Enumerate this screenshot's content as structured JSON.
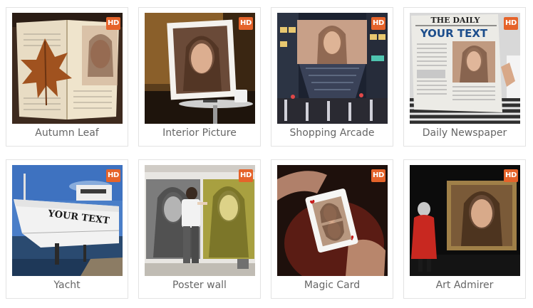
{
  "badge_label": "HD",
  "accent_color": "#e5632a",
  "cards": [
    {
      "title": "Autumn Leaf",
      "thumbnail": "open-book-with-autumn-leaf-and-portrait"
    },
    {
      "title": "Interior Picture",
      "thumbnail": "framed-portrait-on-table"
    },
    {
      "title": "Shopping Arcade",
      "thumbnail": "billboard-over-shopping-street"
    },
    {
      "title": "Daily Newspaper",
      "thumbnail": "newspaper-with-portrait",
      "image_text": {
        "masthead": "THE DAILY",
        "headline": "YOUR TEXT"
      }
    },
    {
      "title": "Yacht",
      "thumbnail": "white-yacht-in-harbor",
      "image_text": {
        "hull": "YOUR TEXT"
      }
    },
    {
      "title": "Poster wall",
      "thumbnail": "artist-painting-poster-wall"
    },
    {
      "title": "Magic Card",
      "thumbnail": "playing-card-with-portrait"
    },
    {
      "title": "Art Admirer",
      "thumbnail": "woman-viewing-framed-painting"
    }
  ]
}
